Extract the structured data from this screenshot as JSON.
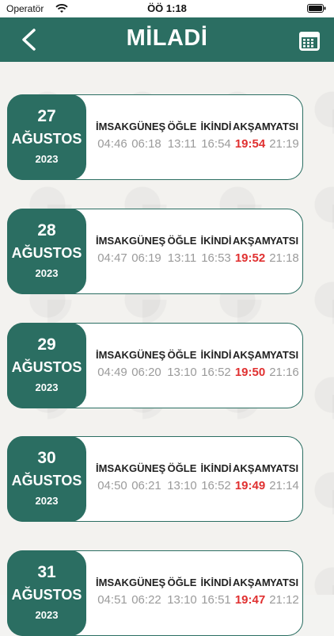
{
  "status": {
    "carrier": "Operatör",
    "time": "ÖÖ 1:18"
  },
  "header": {
    "title": "MİLADİ"
  },
  "columns": [
    "İMSAK",
    "GÜNEŞ",
    "ÖĞLE",
    "İKİNDİ",
    "AKŞAM",
    "YATSI"
  ],
  "days": [
    {
      "day": "27",
      "month": "AĞUSTOS",
      "year": "2023",
      "times": [
        "04:46",
        "06:18",
        "13:11",
        "16:54",
        "19:54",
        "21:19"
      ]
    },
    {
      "day": "28",
      "month": "AĞUSTOS",
      "year": "2023",
      "times": [
        "04:47",
        "06:19",
        "13:11",
        "16:53",
        "19:52",
        "21:18"
      ]
    },
    {
      "day": "29",
      "month": "AĞUSTOS",
      "year": "2023",
      "times": [
        "04:49",
        "06:20",
        "13:10",
        "16:52",
        "19:50",
        "21:16"
      ]
    },
    {
      "day": "30",
      "month": "AĞUSTOS",
      "year": "2023",
      "times": [
        "04:50",
        "06:21",
        "13:10",
        "16:52",
        "19:49",
        "21:14"
      ]
    },
    {
      "day": "31",
      "month": "AĞUSTOS",
      "year": "2023",
      "times": [
        "04:51",
        "06:22",
        "13:10",
        "16:51",
        "19:47",
        "21:12"
      ]
    }
  ],
  "colors": {
    "primary": "#2b6e62",
    "highlight": "#e03030",
    "muted": "#9b9b9b"
  }
}
